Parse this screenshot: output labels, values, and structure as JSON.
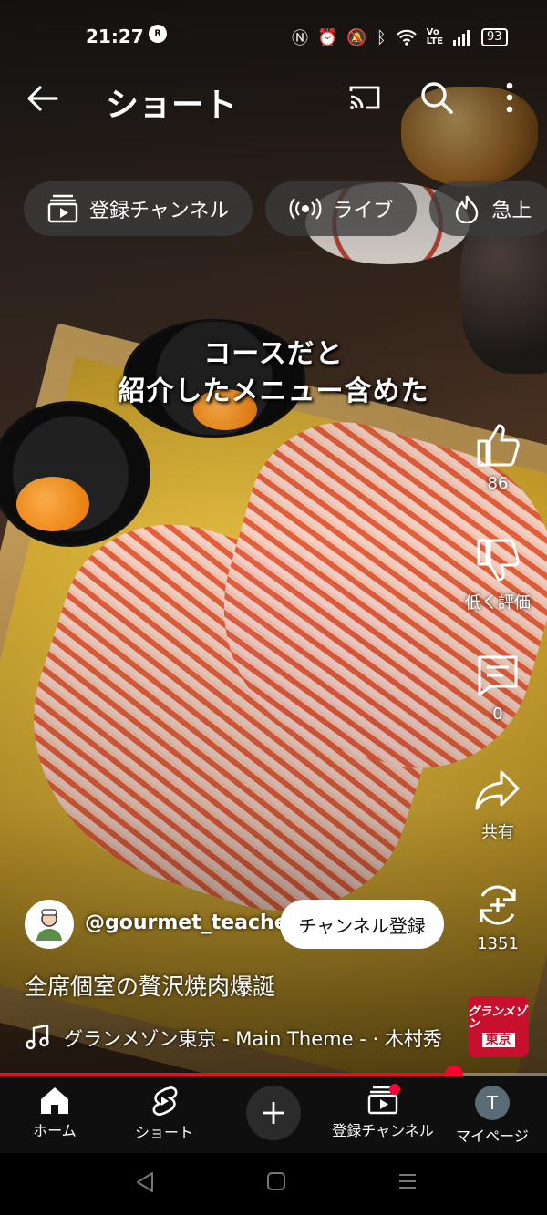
{
  "status_bar": {
    "time": "21:27",
    "rlink_badge": "R",
    "battery": "93"
  },
  "header": {
    "title": "ショート"
  },
  "chips": [
    {
      "label": "登録チャンネル",
      "icon": "subscriptions-icon"
    },
    {
      "label": "ライブ",
      "icon": "live-icon"
    },
    {
      "label": "急上",
      "icon": "trending-icon"
    }
  ],
  "video": {
    "caption_line1": "コースだと",
    "caption_line2": "紹介したメニュー含めた",
    "title": "全席個室の贅沢焼肉爆誕",
    "progress_percent": 83
  },
  "actions": {
    "like_count": "86",
    "dislike_label": "低く評価",
    "comment_count": "0",
    "share_label": "共有",
    "remix_count": "1351"
  },
  "channel": {
    "handle": "@gourmet_teacher",
    "subscribe_label": "チャンネル登録"
  },
  "music": {
    "text": "グランメゾン東京 - Main Theme - · 木村秀",
    "thumb_line1": "グランメゾン",
    "thumb_line2": "東京"
  },
  "bottom_nav": {
    "home": "ホーム",
    "shorts": "ショート",
    "subscriptions": "登録チャンネル",
    "me": "マイページ",
    "me_initial": "T"
  },
  "colors": {
    "accent": "#ff0033",
    "nav_bg": "#0f0f0f"
  }
}
